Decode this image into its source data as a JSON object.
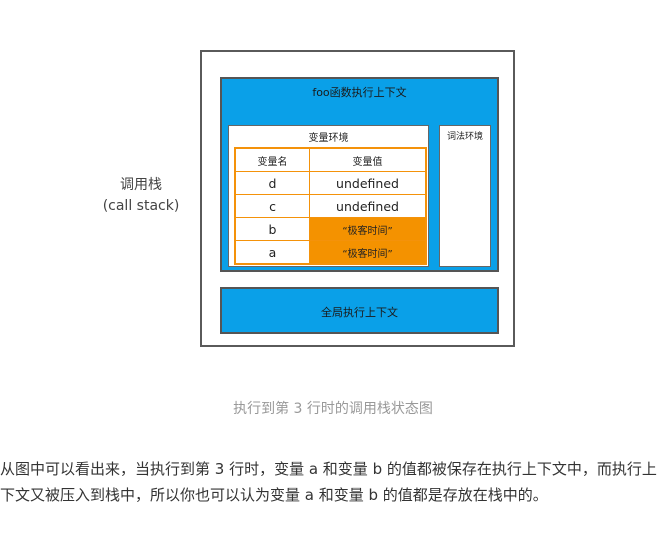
{
  "diagram": {
    "call_stack_label": "调用栈",
    "call_stack_label_en": "(call stack)",
    "foo_context_title": "foo函数执行上下文",
    "variable_env_title": "变量环境",
    "lexical_env_title": "词法环境",
    "table": {
      "headers": [
        "变量名",
        "变量值"
      ],
      "rows": [
        {
          "name": "d",
          "value": "undefined",
          "highlight": false
        },
        {
          "name": "c",
          "value": "undefined",
          "highlight": false
        },
        {
          "name": "b",
          "value": "“极客时间”",
          "highlight": true
        },
        {
          "name": "a",
          "value": "“极客时间”",
          "highlight": true
        }
      ]
    },
    "global_context_title": "全局执行上下文"
  },
  "caption": "执行到第 3 行时的调用栈状态图",
  "paragraph": "从图中可以看出来，当执行到第 3 行时，变量 a 和变量 b 的值都被保存在执行上下文中，而执行上下文又被压入到栈中，所以你也可以认为变量 a 和变量 b 的值都是存放在栈中的。",
  "colors": {
    "context_blue": "#0aa0e8",
    "highlight_orange": "#f49200",
    "caption_gray": "#999999"
  }
}
